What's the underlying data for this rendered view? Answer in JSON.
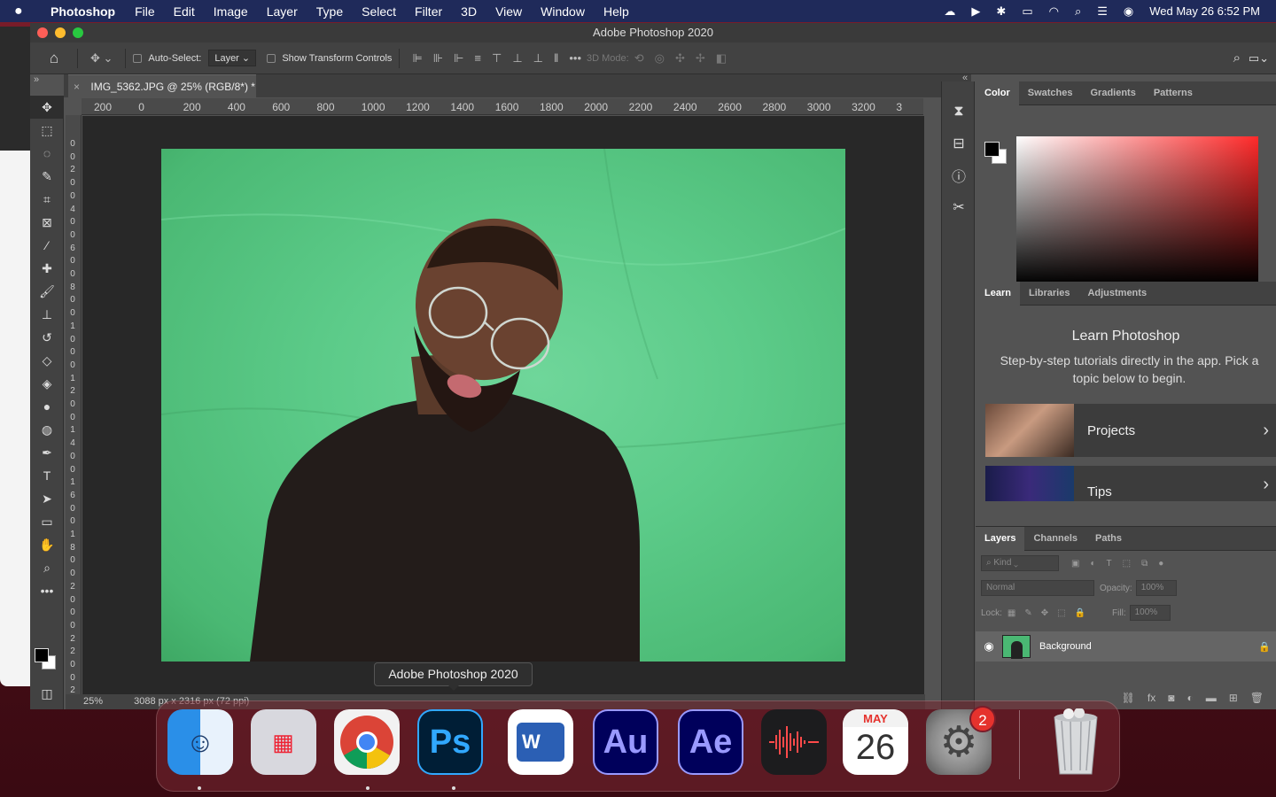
{
  "menubar": {
    "app": "Photoshop",
    "menus": [
      "File",
      "Edit",
      "Image",
      "Layer",
      "Type",
      "Select",
      "Filter",
      "3D",
      "View",
      "Window",
      "Help"
    ],
    "datetime": "Wed May 26  6:52 PM"
  },
  "window": {
    "title": "Adobe Photoshop 2020"
  },
  "options": {
    "auto_select_label": "Auto-Select:",
    "auto_select_value": "Layer",
    "transform_label": "Show Transform Controls",
    "more": "•••",
    "mode_3d": "3D Mode:"
  },
  "document": {
    "tab_title": "IMG_5362.JPG @ 25% (RGB/8*) *",
    "ruler_top": [
      "200",
      "0",
      "200",
      "400",
      "600",
      "800",
      "1000",
      "1200",
      "1400",
      "1600",
      "1800",
      "2000",
      "2200",
      "2400",
      "2600",
      "2800",
      "3000",
      "3200",
      "3"
    ],
    "ruler_left": [
      "0",
      "0",
      "2",
      "0",
      "0",
      "4",
      "0",
      "0",
      "6",
      "0",
      "0",
      "8",
      "0",
      "0",
      "1",
      "0",
      "0",
      "0",
      "1",
      "2",
      "0",
      "0",
      "1",
      "4",
      "0",
      "0",
      "1",
      "6",
      "0",
      "0",
      "1",
      "8",
      "0",
      "0",
      "2",
      "0",
      "0",
      "0",
      "2",
      "2",
      "0",
      "0",
      "2"
    ],
    "zoom": "25%",
    "dimensions": "3088 px x 2316 px (72 ppi)"
  },
  "color_panel": {
    "tabs": [
      "Color",
      "Swatches",
      "Gradients",
      "Patterns"
    ],
    "active_tab": "Color"
  },
  "learn_panel": {
    "tabs": [
      "Learn",
      "Libraries",
      "Adjustments"
    ],
    "title": "Learn Photoshop",
    "description": "Step-by-step tutorials directly in the app. Pick a topic below to begin.",
    "cards": [
      {
        "label": "Projects"
      },
      {
        "label": "Tips"
      }
    ]
  },
  "layers_panel": {
    "tabs": [
      "Layers",
      "Channels",
      "Paths"
    ],
    "kind_placeholder": "Kind",
    "blend_mode": "Normal",
    "opacity_label": "Opacity:",
    "opacity_value": "100%",
    "lock_label": "Lock:",
    "fill_label": "Fill:",
    "fill_value": "100%",
    "layers": [
      {
        "name": "Background",
        "visible": true,
        "locked": true
      }
    ]
  },
  "tooltip": {
    "text": "Adobe Photoshop 2020"
  },
  "dock": {
    "items": [
      "Finder",
      "Launchpad",
      "Chrome",
      "Photoshop",
      "Word",
      "Audition",
      "After Effects",
      "Voice Memos",
      "Calendar",
      "System Preferences",
      "Trash"
    ],
    "ps_label": "Ps",
    "au_label": "Au",
    "ae_label": "Ae",
    "word_label": "W",
    "calendar_month": "MAY",
    "calendar_day": "26",
    "settings_badge": "2"
  },
  "colors": {
    "ps_bg": "#535353",
    "panel": "#424242",
    "green_screen": "#5ccb89",
    "accent_red": "#e5322d"
  }
}
